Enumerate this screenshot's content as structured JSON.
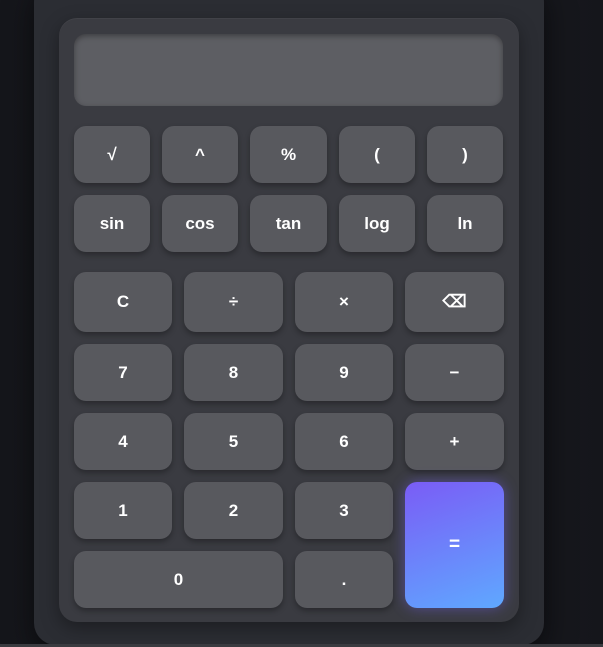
{
  "display": {
    "value": ""
  },
  "scientific_row_1": [
    "√",
    "^",
    "%",
    "(",
    ")"
  ],
  "scientific_row_2": [
    "sin",
    "cos",
    "tan",
    "log",
    "ln"
  ],
  "basic": {
    "clear": "C",
    "divide": "÷",
    "multiply": "×",
    "backspace": "⌫",
    "seven": "7",
    "eight": "8",
    "nine": "9",
    "minus": "−",
    "four": "4",
    "five": "5",
    "six": "6",
    "plus": "+",
    "one": "1",
    "two": "2",
    "three": "3",
    "equals": "=",
    "zero": "0",
    "decimal": "."
  },
  "colors": {
    "equals_gradient_start": "#7a5cf6",
    "equals_gradient_end": "#5fa8ff",
    "button": "#58595e"
  }
}
